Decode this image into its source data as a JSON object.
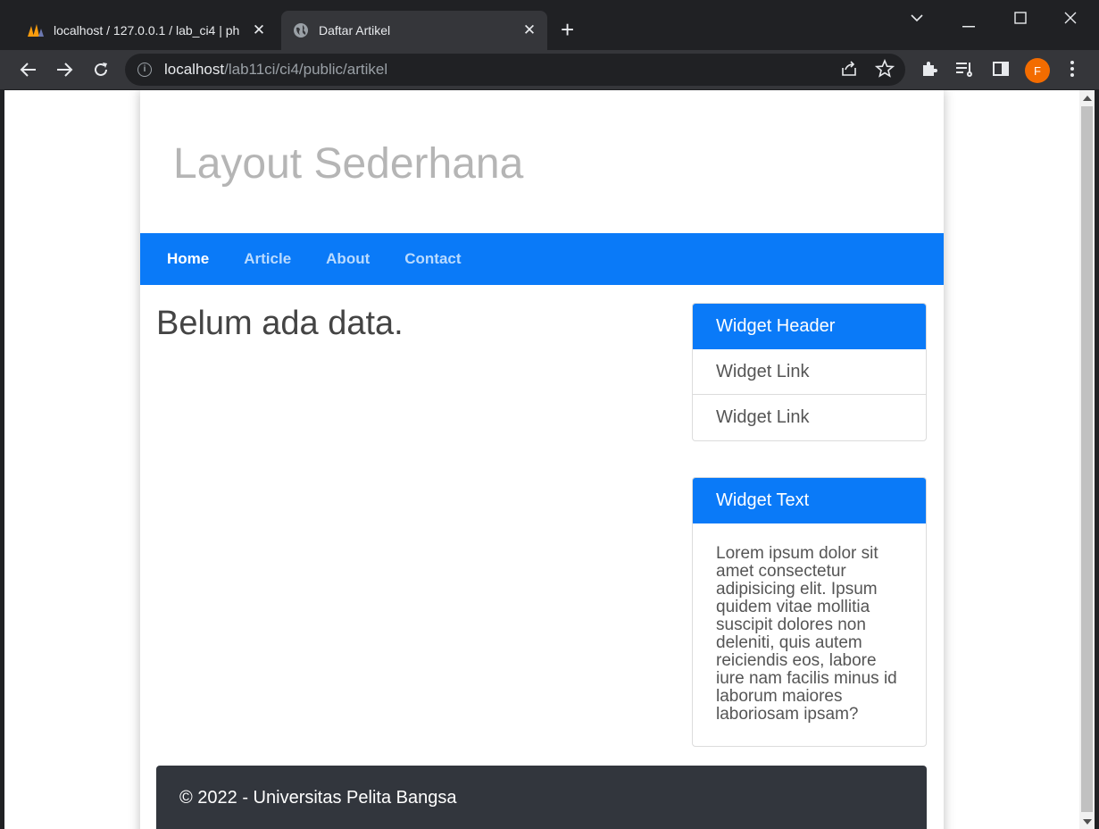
{
  "browser": {
    "tabs": [
      {
        "title": "localhost / 127.0.0.1 / lab_ci4 | ph",
        "favicon": "phpmyadmin-icon"
      },
      {
        "title": "Daftar Artikel",
        "favicon": "globe-icon"
      }
    ],
    "url_host": "localhost",
    "url_path": "/lab11ci/ci4/public/artikel",
    "profile_initial": "F"
  },
  "page": {
    "site_title": "Layout Sederhana",
    "nav": [
      {
        "label": "Home",
        "active": true
      },
      {
        "label": "Article",
        "active": false
      },
      {
        "label": "About",
        "active": false
      },
      {
        "label": "Contact",
        "active": false
      }
    ],
    "content_message": "Belum ada data.",
    "widget_links": {
      "header": "Widget Header",
      "links": [
        "Widget Link",
        "Widget Link"
      ]
    },
    "widget_text": {
      "header": "Widget Text",
      "body": "Lorem ipsum dolor sit amet consectetur adipisicing elit. Ipsum quidem vitae mollitia suscipit dolores non deleniti, quis autem reiciendis eos, labore iure nam facilis minus id laborum maiores laboriosam ipsam?"
    },
    "footer": "© 2022 - Universitas Pelita Bangsa"
  },
  "colors": {
    "accent": "#0a7af8",
    "footer_bg": "#32363d",
    "avatar_bg": "#f36c00"
  }
}
